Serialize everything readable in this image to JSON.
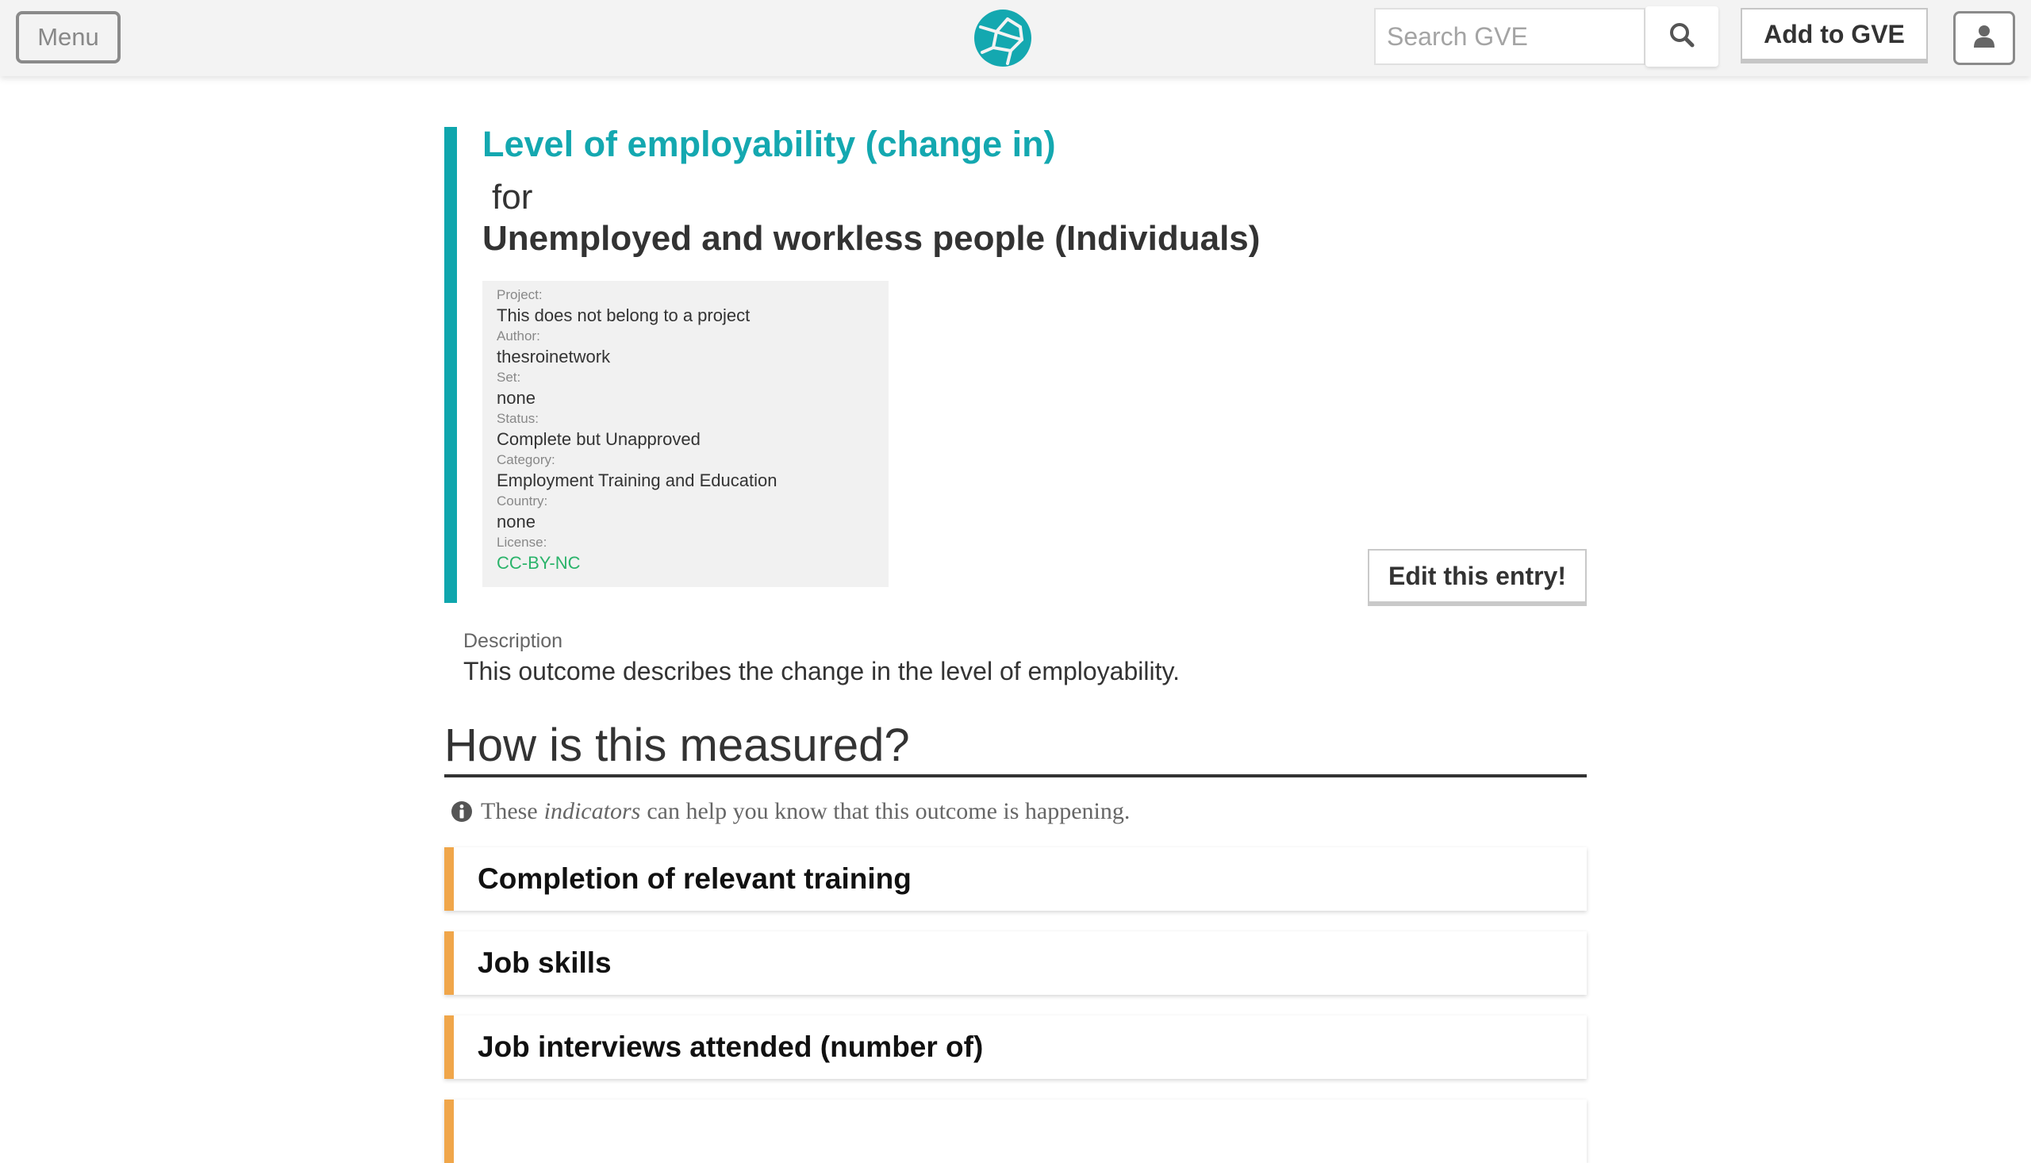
{
  "topbar": {
    "menu_label": "Menu",
    "search_placeholder": "Search GVE",
    "add_label": "Add to GVE",
    "logo_icon": "globe-network-logo",
    "search_icon": "search-icon",
    "user_icon": "user-icon"
  },
  "outcome": {
    "title": "Level of employability (change in)",
    "for_label": "for",
    "stakeholder": "Unemployed and workless people (Individuals)"
  },
  "meta": {
    "project_label": "Project:",
    "project_value": "This does not belong to a project",
    "author_label": "Author:",
    "author_value": "thesroinetwork",
    "set_label": "Set:",
    "set_value": "none",
    "status_label": "Status:",
    "status_value": "Complete but Unapproved",
    "category_label": "Category:",
    "category_value": "Employment Training and Education",
    "country_label": "Country:",
    "country_value": "none",
    "license_label": "License:",
    "license_value": "CC-BY-NC"
  },
  "edit_label": "Edit this entry!",
  "description": {
    "label": "Description",
    "text": "This outcome describes the change in the level of employability."
  },
  "measured": {
    "title": "How is this measured?",
    "hint_pre": "These",
    "hint_em": "indicators",
    "hint_post": "can help you know that this outcome is happening."
  },
  "indicators": [
    "Completion of relevant training",
    "Job skills",
    "Job interviews attended (number of)"
  ],
  "colors": {
    "brand_teal": "#14a8b0",
    "indicator_accent": "#f0a64a",
    "license_green": "#2ab36a"
  }
}
